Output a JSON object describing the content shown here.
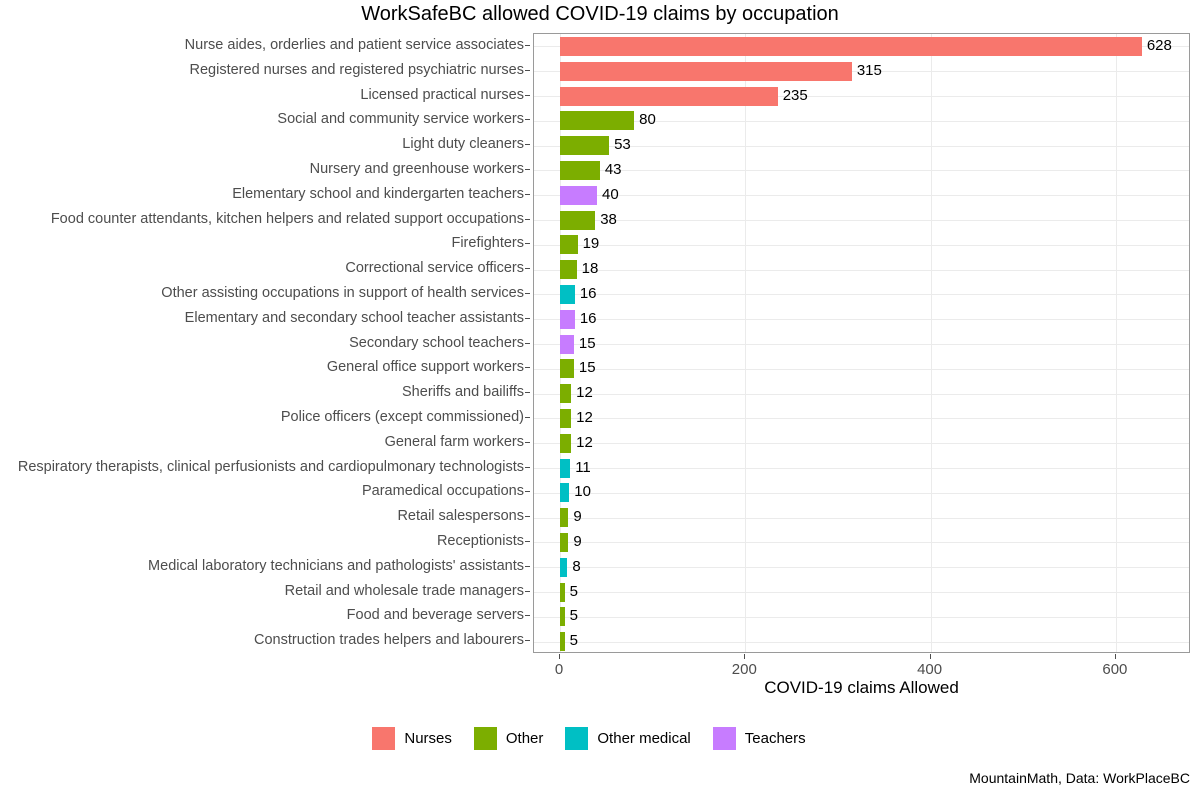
{
  "chart_data": {
    "type": "bar",
    "orientation": "horizontal",
    "title": "WorkSafeBC allowed COVID-19 claims by occupation",
    "xlabel": "COVID-19 claims Allowed",
    "ylabel": "",
    "xlim": [
      0,
      680
    ],
    "xticks": [
      0,
      200,
      400,
      600
    ],
    "xtick_labels": [
      "0",
      "200",
      "400",
      "600"
    ],
    "grid": true,
    "legend_position": "bottom",
    "caption": "MountainMath, Data: WorkPlaceBC",
    "categories": [
      "Nurse aides, orderlies and patient service associates",
      "Registered nurses and registered psychiatric nurses",
      "Licensed practical nurses",
      "Social and community service workers",
      "Light duty cleaners",
      "Nursery and greenhouse workers",
      "Elementary school and kindergarten teachers",
      "Food counter attendants, kitchen helpers and related support occupations",
      "Firefighters",
      "Correctional service officers",
      "Other assisting occupations in support of health services",
      "Elementary and secondary school teacher assistants",
      "Secondary school teachers",
      "General office support workers",
      "Sheriffs and bailiffs",
      "Police officers (except commissioned)",
      "General farm workers",
      "Respiratory therapists, clinical perfusionists and cardiopulmonary technologists",
      "Paramedical occupations",
      "Retail salespersons",
      "Receptionists",
      "Medical laboratory technicians and pathologists' assistants",
      "Retail and wholesale trade managers",
      "Food and beverage servers",
      "Construction trades helpers and labourers"
    ],
    "values": [
      628,
      315,
      235,
      80,
      53,
      43,
      40,
      38,
      19,
      18,
      16,
      16,
      15,
      15,
      12,
      12,
      12,
      11,
      10,
      9,
      9,
      8,
      5,
      5,
      5
    ],
    "groups": [
      "Nurses",
      "Nurses",
      "Nurses",
      "Other",
      "Other",
      "Other",
      "Teachers",
      "Other",
      "Other",
      "Other",
      "Other medical",
      "Teachers",
      "Teachers",
      "Other",
      "Other",
      "Other",
      "Other",
      "Other medical",
      "Other medical",
      "Other",
      "Other",
      "Other medical",
      "Other",
      "Other",
      "Other"
    ],
    "legend": [
      {
        "label": "Nurses",
        "color": "#F8766D"
      },
      {
        "label": "Other",
        "color": "#7CAE00"
      },
      {
        "label": "Other medical",
        "color": "#00BFC4"
      },
      {
        "label": "Teachers",
        "color": "#C77CFF"
      }
    ]
  }
}
